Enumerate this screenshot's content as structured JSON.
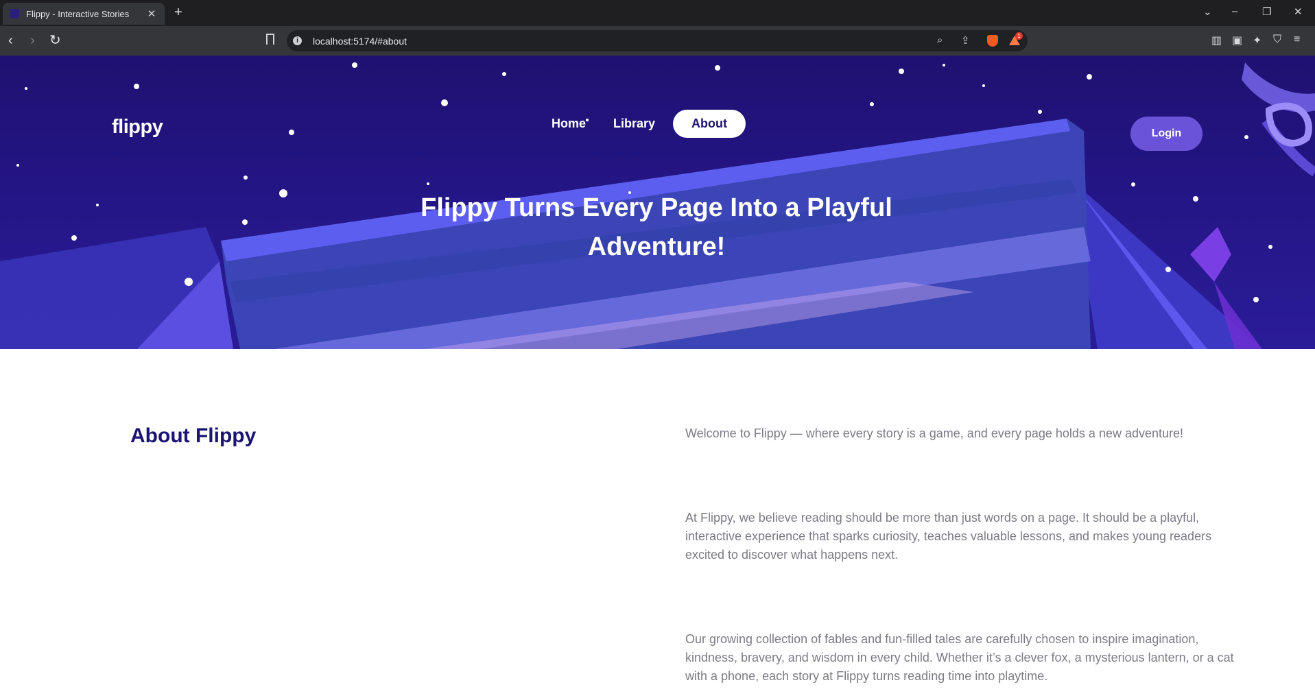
{
  "browser": {
    "tab_title": "Flippy - Interactive Stories",
    "tab_close": "✕",
    "new_tab": "+",
    "url": "localhost:5174/#about",
    "info_glyph": "i",
    "shields_badge": "1",
    "controls": {
      "tab_list": "⌄",
      "minimize": "–",
      "restore": "❐",
      "close": "✕"
    },
    "nav": {
      "back": "‹",
      "forward": "›",
      "reload": "↻"
    }
  },
  "site": {
    "brand": "flippy",
    "nav": [
      {
        "label": "Home",
        "active": false
      },
      {
        "label": "Library",
        "active": false
      },
      {
        "label": "About",
        "active": true
      }
    ],
    "login_label": "Login",
    "hero_title": "Flippy Turns Every Page Into a Playful Adventure!"
  },
  "about": {
    "heading": "About Flippy",
    "paragraphs": [
      "Welcome to Flippy — where every story is a game, and every page holds a new adventure!",
      "At Flippy, we believe reading should be more than just words on a page. It should be a playful, interactive experience that sparks curiosity, teaches valuable lessons, and makes young readers excited to discover what happens next.",
      "Our growing collection of fables and fun-filled tales are carefully chosen to inspire imagination, kindness, bravery, and wisdom in every child. Whether it’s a clever fox, a mysterious lantern, or a cat with a phone, each story at Flippy turns reading time into playtime."
    ]
  },
  "colors": {
    "hero_bg": "#1e1170",
    "accent": "#6a53d8",
    "heading": "#1c1473",
    "body_text": "#7b7b84"
  }
}
